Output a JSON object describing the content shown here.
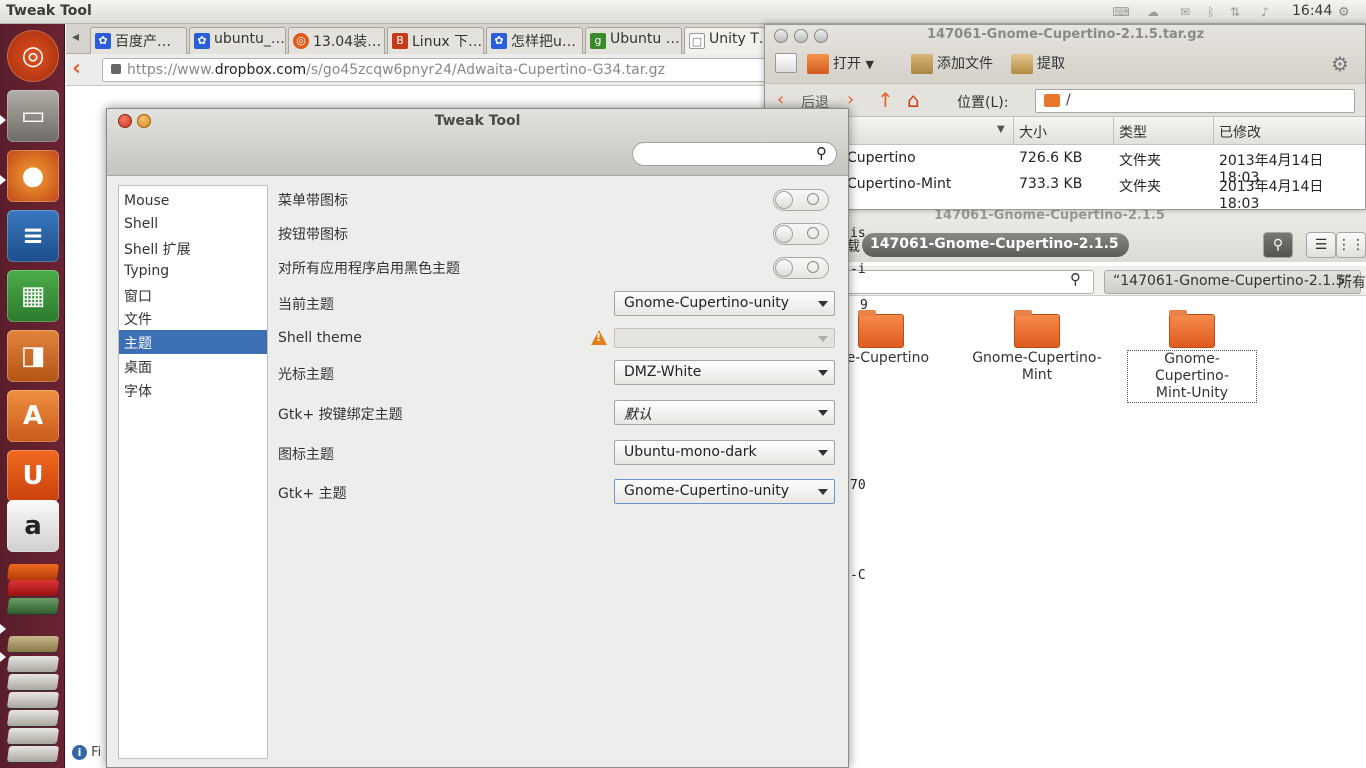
{
  "top_panel": {
    "title": "Tweak Tool",
    "clock": "16:44"
  },
  "browser": {
    "tabs": [
      {
        "label": "百度产…",
        "fav": "paw"
      },
      {
        "label": "ubuntu_…",
        "fav": "paw"
      },
      {
        "label": "13.04装…",
        "fav": "ubuntu"
      },
      {
        "label": "Linux 下…",
        "fav": "b"
      },
      {
        "label": "怎样把u…",
        "fav": "paw"
      },
      {
        "label": "Ubuntu …",
        "fav": "g"
      },
      {
        "label": "Unity T…",
        "fav": "doc"
      }
    ],
    "url_prefix": "https://www.",
    "url_domain": "dropbox.com",
    "url_rest": "/s/go45zcqw6pnyr24/Adwaita-Cupertino-G34.tar.gz",
    "status": "Fi"
  },
  "fm1": {
    "title": "147061-Gnome-Cupertino-2.1.5.tar.gz",
    "open_btn": "打开",
    "add_file_btn": "添加文件",
    "extract_btn": "提取",
    "back_btn": "后退",
    "location_label": "位置(L):",
    "location_value": "/",
    "columns": {
      "size": "大小",
      "type": "类型",
      "modified": "已修改"
    },
    "rows": [
      {
        "name": "Cupertino",
        "size": "726.6 KB",
        "type": "文件夹",
        "modified": "2013年4月14日 18:03"
      },
      {
        "name": "Cupertino-Mint",
        "size": "733.3 KB",
        "type": "文件夹",
        "modified": "2013年4月14日 18:03"
      }
    ]
  },
  "fm2": {
    "title": "147061-Gnome-Cupertino-2.1.5",
    "crumb": "147061-Gnome-Cupertino-2.1.5",
    "crumb_prefix": "载",
    "search_tag": "“147061-Gnome-Cupertino-2.1.5”",
    "search_tag2": "所有",
    "folders": [
      {
        "line1": "me-Cupertino",
        "line2": ""
      },
      {
        "line1": "Gnome-Cupertino-",
        "line2": "Mint"
      },
      {
        "line1": "Gnome-Cupertino-",
        "line2": "Mint-Unity"
      }
    ],
    "term_lines": [
      "is",
      "-i",
      "9",
      "70",
      "-C"
    ]
  },
  "tweak": {
    "title": "Tweak Tool",
    "sidebar": [
      "Mouse",
      "Shell",
      "Shell 扩展",
      "Typing",
      "窗口",
      "文件",
      "主题",
      "桌面",
      "字体"
    ],
    "selected": "主题",
    "toggles": [
      {
        "label": "菜单带图标",
        "on": false
      },
      {
        "label": "按钮带图标",
        "on": false
      },
      {
        "label": "对所有应用程序启用黑色主题",
        "on": false
      }
    ],
    "combos": [
      {
        "label": "当前主题",
        "value": "Gnome-Cupertino-unity"
      },
      {
        "label": "Shell theme",
        "value": ""
      },
      {
        "label": "光标主题",
        "value": "DMZ-White"
      },
      {
        "label": "Gtk+ 按键绑定主题",
        "value": "默认"
      },
      {
        "label": "图标主题",
        "value": "Ubuntu-mono-dark"
      },
      {
        "label": "Gtk+ 主题",
        "value": "Gnome-Cupertino-unity"
      }
    ]
  },
  "colors": {
    "accent": "#3d6fb4",
    "launcher": "#5e1f2e",
    "warning": "#e87d1e"
  }
}
